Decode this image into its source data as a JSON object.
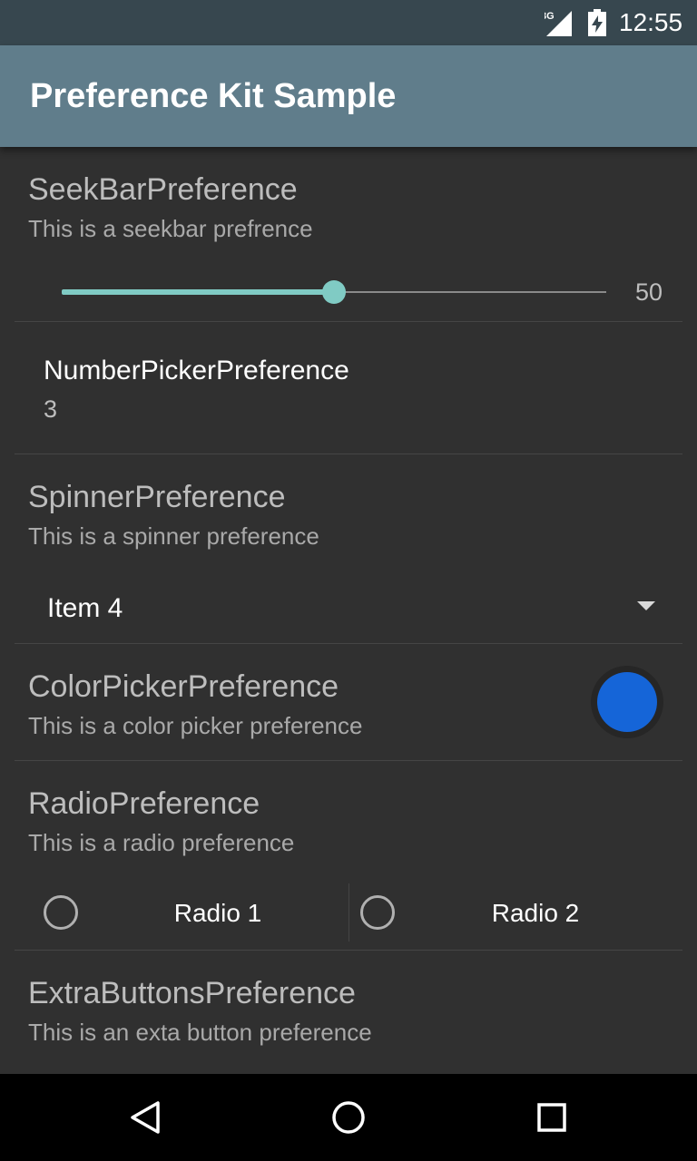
{
  "status_bar": {
    "network": "3G",
    "time": "12:55",
    "icons": [
      "signal-icon",
      "battery-charging-icon"
    ]
  },
  "app_bar": {
    "title": "Preference Kit Sample",
    "color": "#607d8b"
  },
  "preferences": {
    "seekbar": {
      "title": "SeekBarPreference",
      "summary": "This is a seekbar prefrence",
      "value": "50",
      "fraction": 0.5,
      "accent": "#80cbc4"
    },
    "number_picker": {
      "title": "NumberPickerPreference",
      "value": "3"
    },
    "spinner": {
      "title": "SpinnerPreference",
      "summary": "This is a spinner preference",
      "selected": "Item 4"
    },
    "color_picker": {
      "title": "ColorPickerPreference",
      "summary": "This is a color picker preference",
      "color": "#1565d8"
    },
    "radio": {
      "title": "RadioPreference",
      "summary": "This is a radio preference",
      "options": [
        {
          "label": "Radio 1",
          "checked": false
        },
        {
          "label": "Radio 2",
          "checked": false
        }
      ]
    },
    "extra_buttons": {
      "title": "ExtraButtonsPreference",
      "summary": "This is an exta button preference"
    }
  },
  "nav_bar": {
    "icons": [
      "back-icon",
      "home-icon",
      "recents-icon"
    ]
  }
}
